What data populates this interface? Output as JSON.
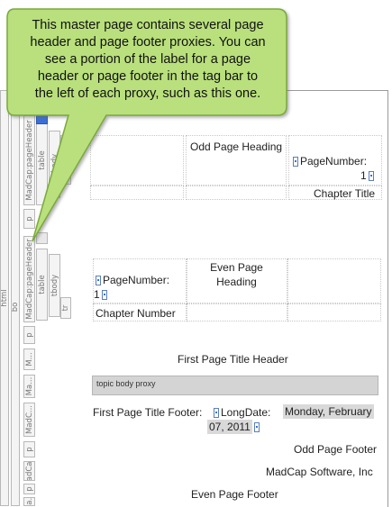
{
  "callout": {
    "text_lines": [
      "This master page contains several page",
      "header and page footer proxies. You can",
      "see a portion of the label for a page",
      "header or page footer in the tag bar to",
      "the left of each proxy, such as this one."
    ],
    "fill_color": "#b9e07c",
    "border_color": "#7aa93a"
  },
  "tagbar": {
    "html": "html",
    "body": "bo",
    "header1": "MadCap:pageHeader",
    "table": "table",
    "tbody": "tbody",
    "tr": "tr",
    "p": "p",
    "header2": "MadCap:pageHeader",
    "m1": "M...",
    "ma": "Ma...",
    "madc": "MadC...",
    "madca": "MadCa...",
    "ca": "Ca..."
  },
  "header1": {
    "center": "Odd Page Heading",
    "page_number_label": "PageNumber:",
    "page_number_value": "1",
    "chapter_title": "Chapter Title"
  },
  "header2": {
    "page_number_label": "PageNumber:",
    "page_number_value": "1",
    "center": "Even Page Heading",
    "chapter_number": "Chapter Number"
  },
  "first_page": {
    "title_header": "First Page Title Header",
    "topic_body_proxy": "topic body proxy",
    "footer_label": "First Page Title Footer:",
    "long_date_label": "LongDate:",
    "long_date_value_1": "Monday, February",
    "long_date_value_2": "07, 2011"
  },
  "footers": {
    "odd": "Odd Page Footer",
    "company": "MadCap Software, Inc",
    "even": "Even Page Footer"
  }
}
